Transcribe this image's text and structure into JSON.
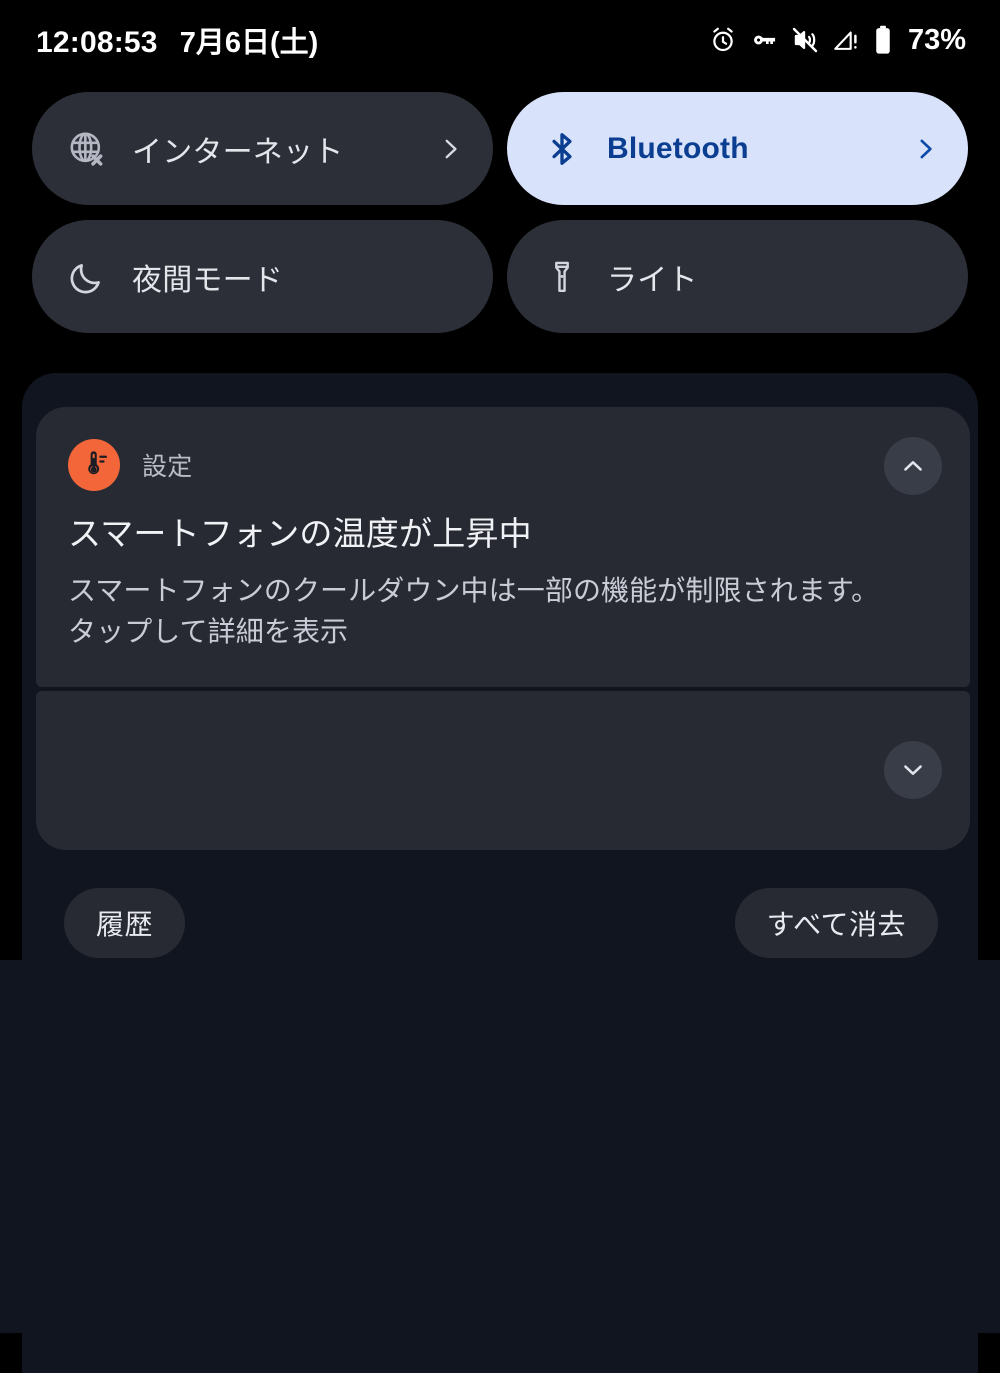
{
  "status_bar": {
    "clock": "12:08:53",
    "date": "7月6日(土)",
    "battery_percent": "73%",
    "icons": [
      {
        "name": "alarm-icon"
      },
      {
        "name": "vpn-key-icon"
      },
      {
        "name": "ringer-muted-icon"
      },
      {
        "name": "signal-no-service-icon"
      },
      {
        "name": "battery-icon"
      }
    ]
  },
  "quick_settings": {
    "tiles": [
      {
        "id": "internet",
        "label": "インターネット",
        "icon": "globe-off-icon",
        "active": false,
        "has_chevron": true
      },
      {
        "id": "bluetooth",
        "label": "Bluetooth",
        "icon": "bluetooth-icon",
        "active": true,
        "has_chevron": true
      },
      {
        "id": "night-mode",
        "label": "夜間モード",
        "icon": "moon-icon",
        "active": false,
        "has_chevron": false
      },
      {
        "id": "flashlight",
        "label": "ライト",
        "icon": "flashlight-icon",
        "active": false,
        "has_chevron": false
      }
    ],
    "active_background": "#d8e3fb",
    "active_foreground": "#0b3e90",
    "inactive_background": "#2c2f38"
  },
  "notifications": [
    {
      "app_name": "設定",
      "app_icon": "thermometer-icon",
      "app_icon_color": "#f2663a",
      "title": "スマートフォンの温度が上昇中",
      "body_line1": "スマートフォンのクールダウン中は一部の機能が制限されます。",
      "body_line2": "タップして詳細を表示",
      "expand_control": "chevron-up-icon"
    },
    {
      "app_name": "",
      "title": "",
      "body_line1": "",
      "body_line2": "",
      "expand_control": "chevron-down-icon"
    }
  ],
  "footer": {
    "history_label": "履歴",
    "clear_all_label": "すべて消去"
  }
}
